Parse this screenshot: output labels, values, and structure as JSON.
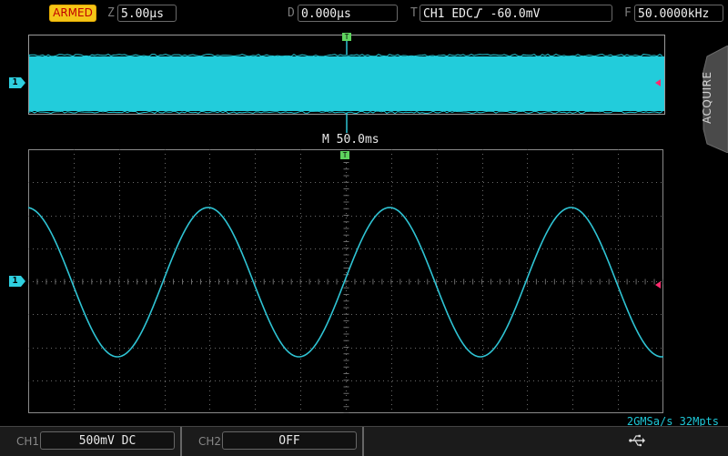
{
  "status": {
    "run_state": "ARMED",
    "zoom_label": "Z",
    "zoom_value": "5.00µs",
    "delay_label": "D",
    "delay_value": "0.000µs",
    "trigger_label": "T",
    "trigger_source": "CH1",
    "trigger_coupling": "EDC",
    "trigger_level": "-60.0mV",
    "freq_label": "F",
    "freq_value": "50.0000kHz"
  },
  "overview": {
    "memory_label": "M",
    "memory_timebase": "50.0ms"
  },
  "channels": {
    "ch1_tag": "1",
    "ch1_color": "#2fd0e0"
  },
  "waveform": {
    "type": "sine",
    "cycles_visible": 3.5,
    "trace_color": "#2fc4d4"
  },
  "acquisition": {
    "sample_info": "2GMSa/s 32Mpts"
  },
  "side_menu": {
    "tab_label": "ACQUIRE"
  },
  "bottom": {
    "ch1_label": "CH1",
    "ch1_setting": "500mV DC",
    "ch2_label": "CH2",
    "ch2_setting": "OFF",
    "usb_icon": "usb-icon"
  },
  "trigger_pos_tag": "T"
}
